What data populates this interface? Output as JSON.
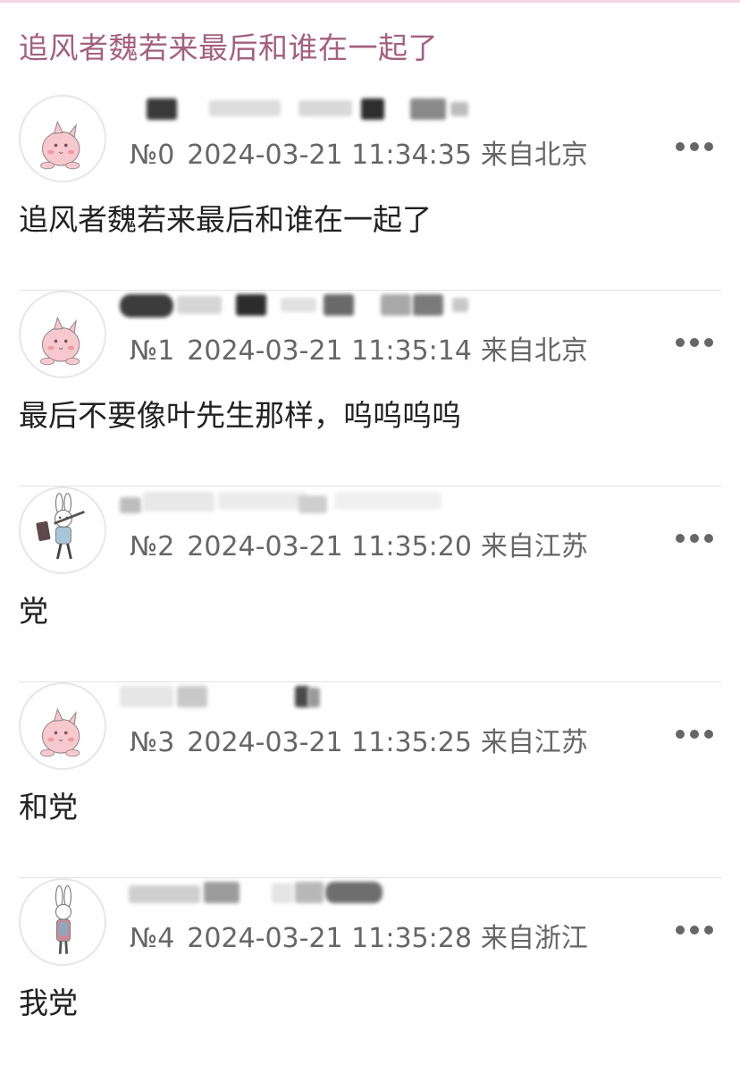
{
  "thread": {
    "title": "追风者魏若来最后和谁在一起了"
  },
  "colors": {
    "title": "#a3617f",
    "meta": "#666666",
    "content": "#222222",
    "divider": "#e3e3e3",
    "accent_bar": "#f3d6e3"
  },
  "posts": [
    {
      "avatar": "pink-puff-avatar-icon",
      "floor": "№0",
      "time": "2024-03-21 11:34:35",
      "location": "来自北京",
      "content": "追风者魏若来最后和谁在一起了"
    },
    {
      "avatar": "pink-puff-avatar-icon",
      "floor": "№1",
      "time": "2024-03-21 11:35:14",
      "location": "来自北京",
      "content": "最后不要像叶先生那样，呜呜呜呜"
    },
    {
      "avatar": "bunny-hammer-avatar-icon",
      "floor": "№2",
      "time": "2024-03-21 11:35:20",
      "location": "来自江苏",
      "content": "党"
    },
    {
      "avatar": "pink-puff-avatar-icon",
      "floor": "№3",
      "time": "2024-03-21 11:35:25",
      "location": "来自江苏",
      "content": "和党"
    },
    {
      "avatar": "bunny-standing-avatar-icon",
      "floor": "№4",
      "time": "2024-03-21 11:35:28",
      "location": "来自浙江",
      "content": "我党"
    }
  ]
}
